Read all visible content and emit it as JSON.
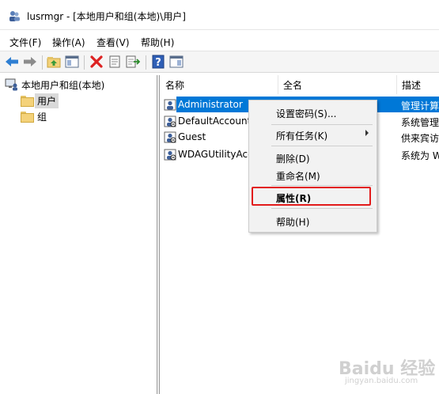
{
  "window": {
    "title": "lusrmgr - [本地用户和组(本地)\\用户]"
  },
  "menu": [
    "文件(F)",
    "操作(A)",
    "查看(V)",
    "帮助(H)"
  ],
  "toolbar": [
    "back-arrow-icon",
    "forward-arrow-icon",
    "up-folder-icon",
    "show-tree-icon",
    "delete-icon",
    "properties-icon",
    "export-icon",
    "help-icon",
    "view-icon"
  ],
  "tree": {
    "root": "本地用户和组(本地)",
    "children": [
      "用户",
      "组"
    ],
    "selected": "用户"
  },
  "list": {
    "columns": [
      "名称",
      "全名",
      "描述"
    ],
    "rows": [
      {
        "name": "Administrator",
        "desc": "管理计算"
      },
      {
        "name": "DefaultAccount",
        "desc": "系统管理"
      },
      {
        "name": "Guest",
        "desc": "供来宾访"
      },
      {
        "name": "WDAGUtilityAcc",
        "desc": "系统为 W"
      }
    ],
    "selected_row": 0
  },
  "context_menu": {
    "items": [
      "设置密码(S)...",
      "所有任务(K)",
      "删除(D)",
      "重命名(M)",
      "属性(R)",
      "帮助(H)"
    ],
    "highlighted": "属性(R)"
  },
  "watermark": {
    "text": "Baidu 经验",
    "sub": "jingyan.baidu.com"
  },
  "colors": {
    "selection": "#0078d7",
    "highlight_box": "#e21b1b"
  }
}
